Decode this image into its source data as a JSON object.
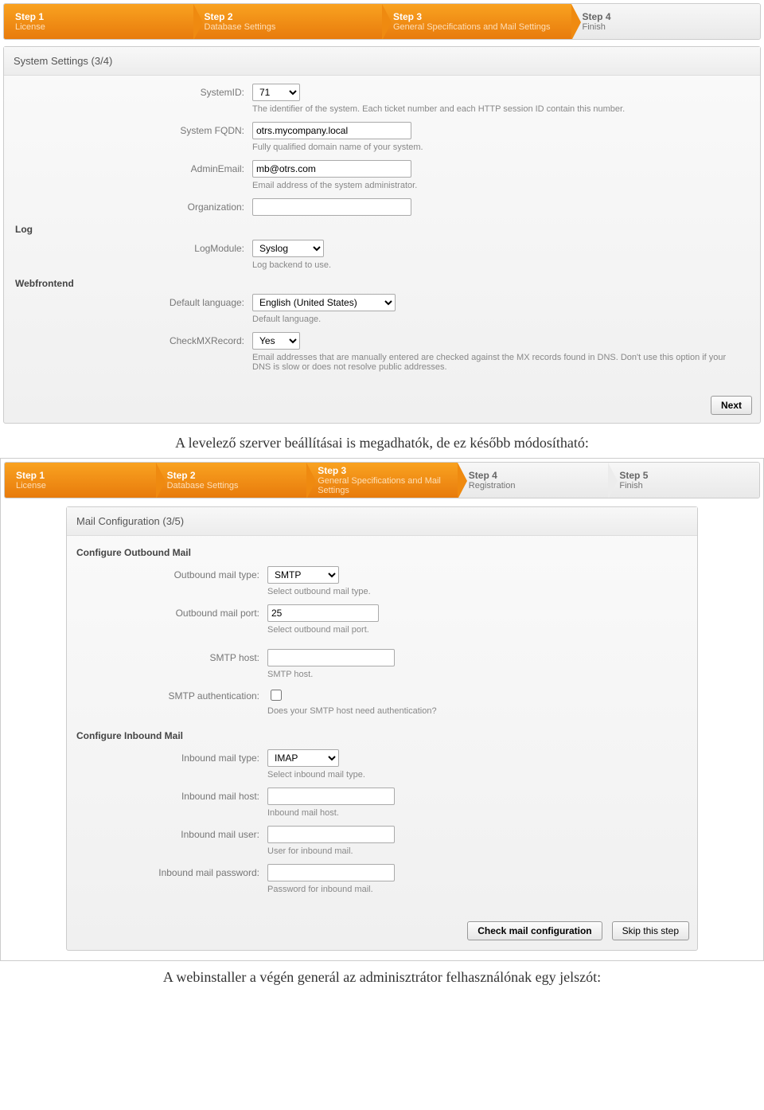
{
  "wizard1": {
    "steps": [
      {
        "title": "Step 1",
        "sub": "License"
      },
      {
        "title": "Step 2",
        "sub": "Database Settings"
      },
      {
        "title": "Step 3",
        "sub": "General Specifications and Mail Settings"
      },
      {
        "title": "Step 4",
        "sub": "Finish"
      }
    ]
  },
  "panel1": {
    "heading": "System Settings (3/4)",
    "systemid": {
      "label": "SystemID:",
      "value": "71",
      "hint": "The identifier of the system. Each ticket number and each HTTP session ID contain this number."
    },
    "fqdn": {
      "label": "System FQDN:",
      "value": "otrs.mycompany.local",
      "hint": "Fully qualified domain name of your system."
    },
    "admin": {
      "label": "AdminEmail:",
      "value": "mb@otrs.com",
      "hint": "Email address of the system administrator."
    },
    "org": {
      "label": "Organization:",
      "value": ""
    },
    "log_section": "Log",
    "logmod": {
      "label": "LogModule:",
      "value": "Syslog",
      "hint": "Log backend to use."
    },
    "web_section": "Webfrontend",
    "lang": {
      "label": "Default language:",
      "value": "English (United States)",
      "hint": "Default language."
    },
    "mx": {
      "label": "CheckMXRecord:",
      "value": "Yes",
      "hint": "Email addresses that are manually entered are checked against the MX records found in DNS. Don't use this option if your DNS is slow or does not resolve public addresses."
    },
    "next": "Next"
  },
  "caption1": "A levelező szerver beállításai is megadhatók, de ez később módosítható:",
  "wizard2": {
    "steps": [
      {
        "title": "Step 1",
        "sub": "License"
      },
      {
        "title": "Step 2",
        "sub": "Database Settings"
      },
      {
        "title": "Step 3",
        "sub": "General Specifications and Mail Settings"
      },
      {
        "title": "Step 4",
        "sub": "Registration"
      },
      {
        "title": "Step 5",
        "sub": "Finish"
      }
    ]
  },
  "panel2": {
    "heading": "Mail Configuration (3/5)",
    "out_section": "Configure Outbound Mail",
    "out_type": {
      "label": "Outbound mail type:",
      "value": "SMTP",
      "hint": "Select outbound mail type."
    },
    "out_port": {
      "label": "Outbound mail port:",
      "value": "25",
      "hint": "Select outbound mail port."
    },
    "smtp_host": {
      "label": "SMTP host:",
      "value": "",
      "hint": "SMTP host."
    },
    "smtp_auth": {
      "label": "SMTP authentication:",
      "hint": "Does your SMTP host need authentication?"
    },
    "in_section": "Configure Inbound Mail",
    "in_type": {
      "label": "Inbound mail type:",
      "value": "IMAP",
      "hint": "Select inbound mail type."
    },
    "in_host": {
      "label": "Inbound mail host:",
      "value": "",
      "hint": "Inbound mail host."
    },
    "in_user": {
      "label": "Inbound mail user:",
      "value": "",
      "hint": "User for inbound mail."
    },
    "in_pass": {
      "label": "Inbound mail password:",
      "value": "",
      "hint": "Password for inbound mail."
    },
    "check_btn": "Check mail configuration",
    "skip_btn": "Skip this step"
  },
  "caption2": "A webinstaller a végén generál az adminisztrátor felhasználónak egy jelszót:"
}
